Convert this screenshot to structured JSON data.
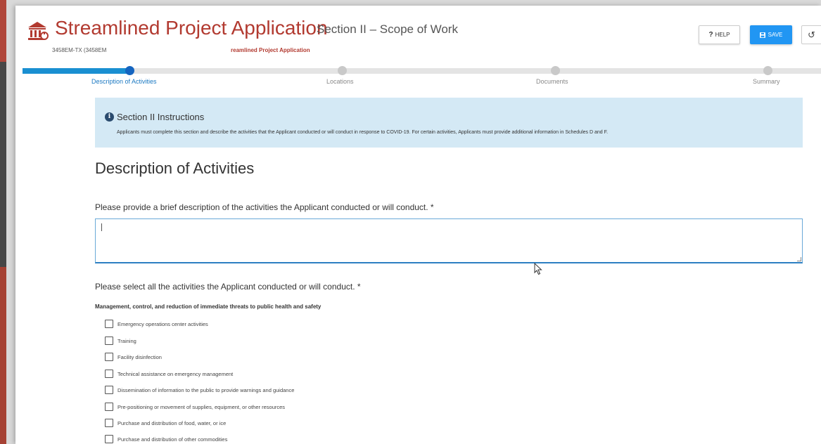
{
  "header": {
    "app_title": "Streamlined Project Application",
    "section_subtitle": "Section II – Scope of Work",
    "meta_id": "3458EM-TX (3458EM",
    "meta_crumb": "reamlined Project Application",
    "help_label": "HELP",
    "help_glyph": "?",
    "save_label": "SAVE",
    "undo_glyph": "↺"
  },
  "stepper": {
    "progress": 0.14,
    "steps": [
      {
        "label": "Description of Activities",
        "active": true
      },
      {
        "label": "Locations",
        "active": false
      },
      {
        "label": "Documents",
        "active": false
      },
      {
        "label": "Summary",
        "active": false
      }
    ]
  },
  "instructions": {
    "title": "Section II Instructions",
    "body": "Applicants must complete this section and describe the activities that the Applicant conducted or will conduct in response to COVID-19. For certain activities, Applicants must provide additional information in Schedules D and F."
  },
  "form": {
    "heading": "Description of Activities",
    "description_question": "Please provide a brief description of the activities the Applicant conducted or will conduct. *",
    "description_value": "",
    "activities_question": "Please select all the activities the Applicant conducted or will conduct.  *",
    "group_label": "Management, control, and reduction of immediate threats to public health and safety",
    "activities": [
      {
        "label": "Emergency operations center activities",
        "checked": false
      },
      {
        "label": "Training",
        "checked": false
      },
      {
        "label": "Facility disinfection",
        "checked": false
      },
      {
        "label": "Technical assistance on emergency management",
        "checked": false
      },
      {
        "label": "Dissemination of information to the public to provide warnings and guidance",
        "checked": false
      },
      {
        "label": "Pre-positioning or movement of supplies, equipment, or other resources",
        "checked": false
      },
      {
        "label": "Purchase and distribution of food, water, or ice",
        "checked": false
      },
      {
        "label": "Purchase and distribution of other commodities",
        "checked": false
      }
    ]
  },
  "colors": {
    "brand": "#b23a30",
    "accent": "#2196f3",
    "info_bg": "#d4e9f5"
  }
}
